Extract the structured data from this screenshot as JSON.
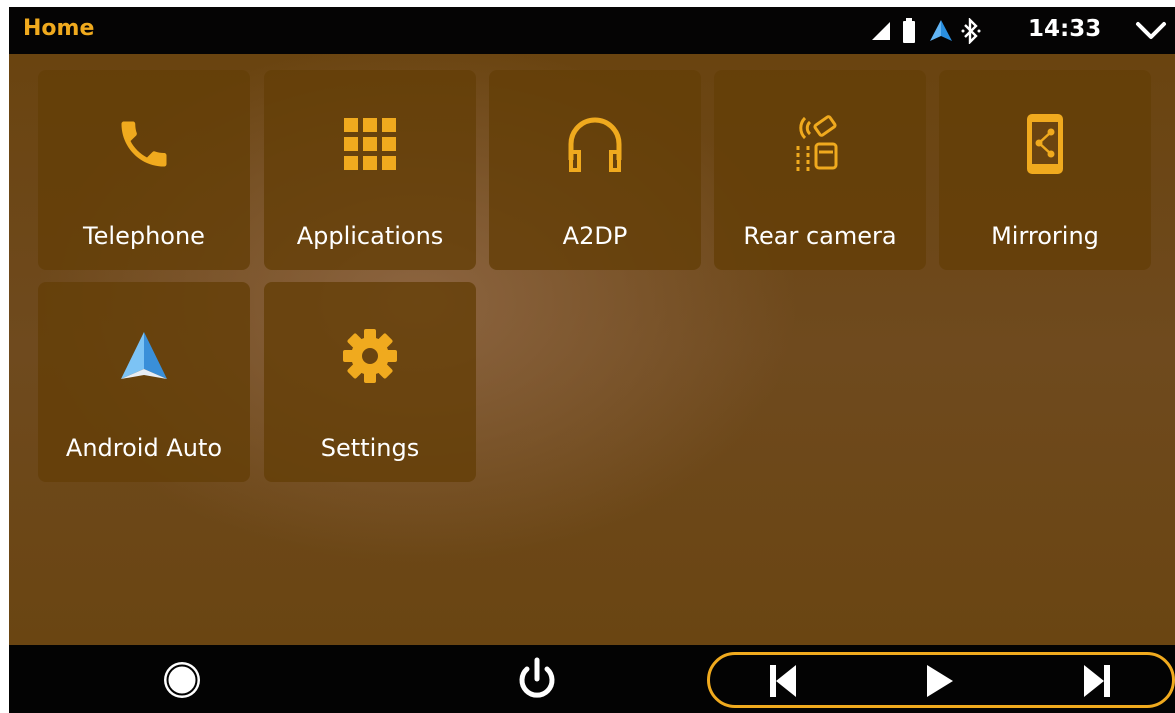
{
  "header": {
    "title": "Home",
    "clock": "14:33",
    "status_icons": [
      "signal-icon",
      "battery-icon",
      "android-auto-status-icon",
      "bluetooth-icon",
      "chevron-down-icon"
    ]
  },
  "apps": [
    {
      "label": "Telephone",
      "icon": "phone-icon"
    },
    {
      "label": "Applications",
      "icon": "grid-icon"
    },
    {
      "label": "A2DP",
      "icon": "headphones-icon"
    },
    {
      "label": "Rear camera",
      "icon": "rear-camera-icon"
    },
    {
      "label": "Mirroring",
      "icon": "mirroring-icon"
    },
    {
      "label": "Android Auto",
      "icon": "android-auto-icon"
    },
    {
      "label": "Settings",
      "icon": "gear-icon"
    }
  ],
  "navbar": {
    "icons": [
      "home-circle-icon",
      "power-icon",
      "previous-track-icon",
      "play-icon",
      "next-track-icon"
    ]
  },
  "colors": {
    "accent": "#f0aa1e",
    "background": "#6f4a1e",
    "bars": "#050404"
  }
}
